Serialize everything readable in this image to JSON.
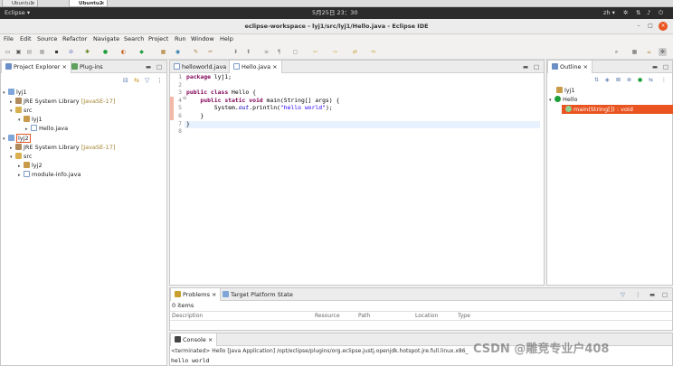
{
  "vm_tabs": [
    {
      "label": "Ubuntu1"
    },
    {
      "label": "Ubuntu2"
    }
  ],
  "topbar": {
    "activities": "Eclipse ▾",
    "clock": "5月25日 23：30",
    "lang": "zh ▾"
  },
  "window": {
    "title": "eclipse-workspace - lyj1/src/lyj1/Hello.java - Eclipse IDE"
  },
  "menu": [
    "File",
    "Edit",
    "Source",
    "Refactor",
    "Navigate",
    "Search",
    "Project",
    "Run",
    "Window",
    "Help"
  ],
  "explorer": {
    "tabs": [
      "Project Explorer",
      "Plug-ins"
    ],
    "tree": [
      {
        "label": "lyj1"
      },
      {
        "label": "JRE System Library",
        "extra": "[JavaSE-17]"
      },
      {
        "label": "src"
      },
      {
        "label": "lyj1"
      },
      {
        "label": "Hello.java"
      },
      {
        "label": "lyj2"
      },
      {
        "label": "JRE System Library",
        "extra": "[JavaSE-17]"
      },
      {
        "label": "src"
      },
      {
        "label": "lyj2"
      },
      {
        "label": "module-info.java"
      }
    ]
  },
  "editor": {
    "tabs": [
      "helloworld.java",
      "Hello.java"
    ],
    "line_numbers": [
      "1",
      "2",
      "3",
      "4",
      "5",
      "6",
      "7",
      "8"
    ],
    "code": {
      "l1_kw": "package",
      "l1_rest": " lyj1;",
      "l3_kw": "public class",
      "l3_rest": " Hello {",
      "l4_kw": "    public static void",
      "l4_rest": " main(String[] args) {",
      "l5_a": "        System.",
      "l5_field": "out",
      "l5_b": ".println(",
      "l5_str": "\"hello world\"",
      "l5_c": ");",
      "l6": "    }",
      "l7": "}"
    }
  },
  "outline": {
    "tab": "Outline",
    "items": [
      {
        "label": "lyj1"
      },
      {
        "label": "Hello"
      },
      {
        "label": "main(String[]) : void"
      }
    ]
  },
  "problems": {
    "tabs": [
      "Problems",
      "Target Platform State"
    ],
    "count": "0 items",
    "columns": [
      "Description",
      "Resource",
      "Path",
      "Location",
      "Type"
    ]
  },
  "console": {
    "tab": "Console",
    "terminated": "<terminated> Hello [Java Application] /opt/eclipse/plugins/org.eclipse.justj.openjdk.hotspot.jre.full.linux.x86_",
    "output": "hello world"
  },
  "watermark": "CSDN @雕竞专业户408",
  "colors": {
    "selection": "#e95420",
    "keyword": "#7f0055",
    "string": "#2a00ff"
  }
}
